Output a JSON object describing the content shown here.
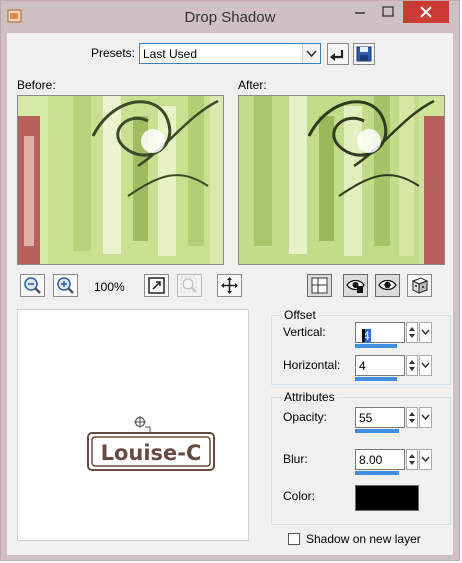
{
  "window": {
    "title": "Drop Shadow"
  },
  "presets": {
    "label": "Presets:",
    "value": "Last Used"
  },
  "previews": {
    "before_label": "Before:",
    "after_label": "After:"
  },
  "zoom": {
    "level": "100%"
  },
  "offset": {
    "title": "Offset",
    "vertical_label": "Vertical:",
    "vertical_value": "4",
    "horizontal_label": "Horizontal:",
    "horizontal_value": "4"
  },
  "attributes": {
    "title": "Attributes",
    "opacity_label": "Opacity:",
    "opacity_value": "55",
    "blur_label": "Blur:",
    "blur_value": "8.00",
    "color_label": "Color:",
    "color_value": "#000000"
  },
  "shadow_on_new_layer": {
    "label": "Shadow on new layer",
    "checked": false
  },
  "nav_preview": {
    "text": "Louise-C"
  },
  "colors": {
    "accent": "#3f8fde",
    "close_button": "#c93b33",
    "window_frame": "#cfc0c3",
    "panel_bg": "#f0f0f0"
  }
}
